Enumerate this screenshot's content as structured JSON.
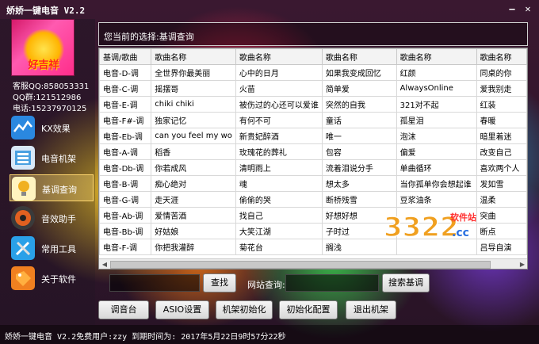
{
  "window": {
    "title": "娇娇一键电音 V2.2"
  },
  "logo": {
    "text": "好吉祥"
  },
  "contact": {
    "service_qq": "客服QQ:858053331",
    "group_qq": "QQ群:121512986",
    "phone": "电话:15237970125"
  },
  "sidebar": {
    "items": [
      {
        "label": "KX效果",
        "icon": "wave-icon",
        "color": "#2a88e0"
      },
      {
        "label": "电音机架",
        "icon": "rack-icon",
        "color": "#4aa0e0"
      },
      {
        "label": "基调查询",
        "icon": "bulb-icon",
        "color": "#f0b020"
      },
      {
        "label": "音效助手",
        "icon": "speaker-icon",
        "color": "#e06020"
      },
      {
        "label": "常用工具",
        "icon": "tools-icon",
        "color": "#2aa0e8"
      },
      {
        "label": "关于软件",
        "icon": "tag-icon",
        "color": "#f08020"
      }
    ]
  },
  "status": {
    "current": "您当前的选择:基调查询"
  },
  "table": {
    "headers": [
      "基调/歌曲",
      "歌曲名称",
      "歌曲名称",
      "歌曲名称",
      "歌曲名称",
      "歌曲名称"
    ],
    "rows": [
      [
        "电音-D-调",
        "全世界你最美丽",
        "心中的日月",
        "如果我变成回忆",
        "红颜",
        "同桌的你"
      ],
      [
        "电音-C-调",
        "摇摆哥",
        "火苗",
        "简单爱",
        "AlwaysOnline",
        "爱我别走"
      ],
      [
        "电音-E-调",
        "chiki chiki",
        "被伤过的心还可以爱谁",
        "突然的自我",
        "321对不起",
        "红装"
      ],
      [
        "电音-F#-调",
        "独家记忆",
        "有何不可",
        "童话",
        "孤星泪",
        "春暖"
      ],
      [
        "电音-Eb-调",
        "can you feel my wo",
        "新贵妃醉酒",
        "唯一",
        "泡沫",
        "暗里着迷"
      ],
      [
        "电音-A-调",
        "稻香",
        "玫瑰花的葬礼",
        "包容",
        "偏爱",
        "改变自己"
      ],
      [
        "电音-Db-调",
        "你若成风",
        "清明雨上",
        "流着泪说分手",
        "单曲循环",
        "喜欢两个人"
      ],
      [
        "电音-B-调",
        "痴心绝对",
        "魂",
        "想太多",
        "当你孤单你会想起谁",
        "发如雪"
      ],
      [
        "电音-G-调",
        "走天涯",
        "偷偷的哭",
        "断桥残雪",
        "豆浆油条",
        "温柔"
      ],
      [
        "电音-Ab-调",
        "爱情苦酒",
        "找自己",
        "好想好想",
        "",
        "突曲"
      ],
      [
        "电音-Bb-调",
        "好姑娘",
        "大笑江湖",
        "子时过",
        "",
        "断点"
      ],
      [
        "电音-F-调",
        "你把我灌醉",
        "菊花台",
        "搁浅",
        "",
        "吕导自演"
      ]
    ]
  },
  "search": {
    "value": "",
    "button": "查找"
  },
  "url_query": {
    "label": "网站查询:",
    "value": "",
    "button": "搜索基调"
  },
  "toolbar": {
    "buttons": [
      "调音台",
      "ASIO设置",
      "机架初始化",
      "初始化配置",
      "退出机架"
    ]
  },
  "statusbar": {
    "text": "娇娇一键电音 V2.2免费用户:zzy  到期时间为: 2017年5月22日9时57分22秒"
  },
  "watermark": {
    "text": "3322",
    "site": "软件站",
    "domain": ".cc"
  }
}
